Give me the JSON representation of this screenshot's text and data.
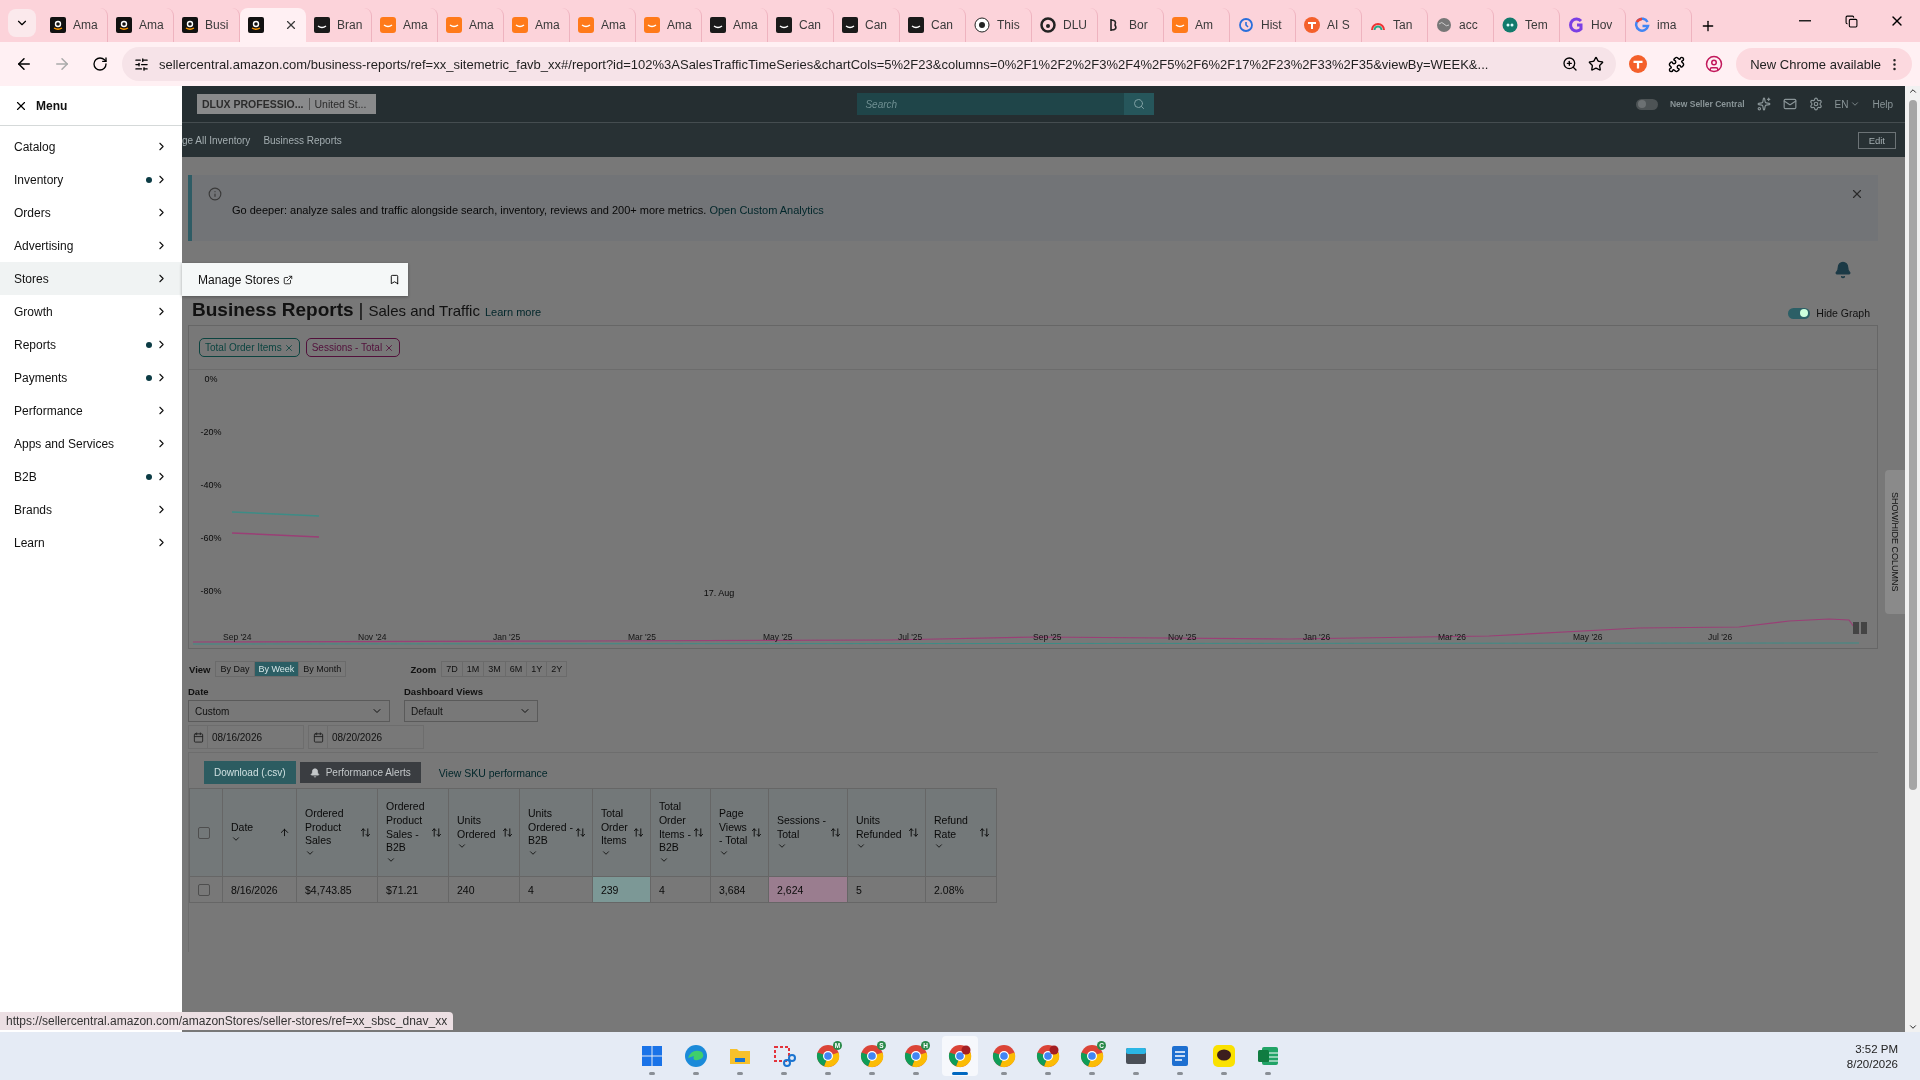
{
  "browser": {
    "tabs": [
      {
        "kind": "amazon",
        "label": "Ama",
        "selected": false
      },
      {
        "kind": "amazon",
        "label": "Ama",
        "selected": false
      },
      {
        "kind": "amazon",
        "label": "Busi",
        "selected": false
      },
      {
        "kind": "amazon",
        "selected": true
      },
      {
        "kind": "amazon-dark",
        "label": "Bran",
        "selected": false
      },
      {
        "kind": "amazon-orange",
        "label": "Ama",
        "selected": false
      },
      {
        "kind": "amazon-orange",
        "label": "Ama",
        "selected": false
      },
      {
        "kind": "amazon-orange",
        "label": "Ama",
        "selected": false
      },
      {
        "kind": "amazon-orange",
        "label": "Ama",
        "selected": false
      },
      {
        "kind": "amazon-orange",
        "label": "Ama",
        "selected": false
      },
      {
        "kind": "amazon-dark",
        "label": "Ama",
        "selected": false
      },
      {
        "kind": "amazon-dark",
        "label": "Can",
        "selected": false
      },
      {
        "kind": "amazon-dark",
        "label": "Can",
        "selected": false
      },
      {
        "kind": "amazon-dark",
        "label": "Can",
        "selected": false
      },
      {
        "kind": "eye",
        "label": "This",
        "selected": false
      },
      {
        "kind": "ring",
        "label": "DLU",
        "selected": false
      },
      {
        "kind": "letter",
        "label": "Bor",
        "selected": false
      },
      {
        "kind": "amazon-orange",
        "label": "Am",
        "selected": false
      },
      {
        "kind": "history",
        "label": "Hist",
        "selected": false
      },
      {
        "kind": "orange",
        "label": "AI S",
        "selected": false
      },
      {
        "kind": "rainbow",
        "label": "Tan",
        "selected": false
      },
      {
        "kind": "globe",
        "label": "acc",
        "selected": false
      },
      {
        "kind": "teal",
        "label": "Tem",
        "selected": false
      },
      {
        "kind": "purple",
        "label": "Hov",
        "selected": false
      },
      {
        "kind": "google",
        "label": "ima",
        "selected": false
      }
    ],
    "url": "sellercentral.amazon.com/business-reports/ref=xx_sitemetric_favb_xx#/report?id=102%3ASalesTrafficTimeSeries&chartCols=5%2F23&columns=0%2F1%2F2%2F3%2F4%2F5%2F6%2F17%2F23%2F33%2F35&viewBy=WEEK&...",
    "update_button": "New Chrome available"
  },
  "menu": {
    "title": "Menu",
    "items": [
      {
        "label": "Catalog",
        "dot": false,
        "selected": false
      },
      {
        "label": "Inventory",
        "dot": true,
        "selected": false
      },
      {
        "label": "Orders",
        "dot": false,
        "selected": false
      },
      {
        "label": "Advertising",
        "dot": false,
        "selected": false
      },
      {
        "label": "Stores",
        "dot": false,
        "selected": true
      },
      {
        "label": "Growth",
        "dot": false,
        "selected": false
      },
      {
        "label": "Reports",
        "dot": true,
        "selected": false
      },
      {
        "label": "Payments",
        "dot": true,
        "selected": false
      },
      {
        "label": "Performance",
        "dot": false,
        "selected": false
      },
      {
        "label": "Apps and Services",
        "dot": false,
        "selected": false
      },
      {
        "label": "B2B",
        "dot": true,
        "selected": false
      },
      {
        "label": "Brands",
        "dot": false,
        "selected": false
      },
      {
        "label": "Learn",
        "dot": false,
        "selected": false
      }
    ],
    "flyout": {
      "label": "Manage Stores"
    }
  },
  "header": {
    "store": "DLUX PROFESSIO...",
    "marketplace": "United St...",
    "search_placeholder": "Search",
    "toggle_label": "New Seller Central",
    "toggle_on": false,
    "language": "EN",
    "help": "Help",
    "breadcrumbs": [
      "ge All Inventory",
      "Business Reports"
    ],
    "edit": "Edit"
  },
  "banner": {
    "text": "Go deeper: analyze sales and traffic alongside search, inventory, reviews and 200+ more metrics.",
    "link": "Open Custom Analytics"
  },
  "report": {
    "title": "Business Reports",
    "separator": "|",
    "subtitle": "Sales and Traffic",
    "learn_more": "Learn more",
    "hide_graph": {
      "label": "Hide Graph",
      "on": true
    }
  },
  "chart": {
    "tags": [
      {
        "label": "Total Order Items",
        "color": "#0c4440"
      },
      {
        "label": "Sessions - Total",
        "color": "#52103b"
      }
    ],
    "y_axis_labels": [
      "0%",
      "-20%",
      "-40%",
      "-60%",
      "-80%"
    ],
    "x_axis_label": "17. Aug",
    "navigator_labels": [
      "Sep '24",
      "Nov '24",
      "Jan '25",
      "Mar '25",
      "May '25",
      "Jul '25",
      "Sep '25",
      "Nov '25",
      "Jan '26",
      "Mar '26",
      "May '26",
      "Jul '26"
    ],
    "side_tab": "SHOW/HIDE COLUMNS"
  },
  "controls": {
    "view_label": "View",
    "views": [
      {
        "label": "By Day",
        "selected": false
      },
      {
        "label": "By Week",
        "selected": true
      },
      {
        "label": "By Month",
        "selected": false
      }
    ],
    "zoom_label": "Zoom",
    "zooms": [
      {
        "label": "7D",
        "selected": false
      },
      {
        "label": "1M",
        "selected": false
      },
      {
        "label": "3M",
        "selected": false
      },
      {
        "label": "6M",
        "selected": false
      },
      {
        "label": "1Y",
        "selected": false
      },
      {
        "label": "2Y",
        "selected": false
      }
    ],
    "date_label": "Date",
    "date_range": "Custom",
    "dashboard_label": "Dashboard Views",
    "dashboard": "Default",
    "start_date": "08/16/2026",
    "end_date": "08/20/2026"
  },
  "actions": {
    "download": "Download (.csv)",
    "alerts": "Performance Alerts",
    "sku": "View SKU performance"
  },
  "table": {
    "header_checked": false,
    "columns": [
      {
        "lines": [
          "Date"
        ],
        "sorted": true
      },
      {
        "lines": [
          "Ordered",
          "Product",
          "Sales"
        ],
        "sorted": false
      },
      {
        "lines": [
          "Ordered",
          "Product",
          "Sales -",
          "B2B"
        ],
        "sorted": false
      },
      {
        "lines": [
          "Units",
          "Ordered"
        ],
        "sorted": false
      },
      {
        "lines": [
          "Units",
          "Ordered -",
          "B2B"
        ],
        "sorted": false
      },
      {
        "lines": [
          "Total",
          "Order",
          "Items"
        ],
        "sorted": false,
        "color": "#7c9896"
      },
      {
        "lines": [
          "Total",
          "Order",
          "Items -",
          "B2B"
        ],
        "sorted": false
      },
      {
        "lines": [
          "Page",
          "Views",
          "- Total"
        ],
        "sorted": false
      },
      {
        "lines": [
          "Sessions -",
          "Total"
        ],
        "sorted": false,
        "color": "#9a7d8f"
      },
      {
        "lines": [
          "Units",
          "Refunded"
        ],
        "sorted": false
      },
      {
        "lines": [
          "Refund",
          "Rate"
        ],
        "sorted": false
      }
    ],
    "rows": [
      {
        "checked": false,
        "cells": [
          "8/16/2026",
          "$4,743.85",
          "$71.21",
          "240",
          "4",
          "239",
          "4",
          "3,684",
          "2,624",
          "5",
          "2.08%"
        ]
      }
    ]
  },
  "status_url": "https://sellercentral.amazon.com/amazonStores/seller-stores/ref=xx_sbsc_dnav_xx",
  "taskbar": {
    "apps": [
      {
        "kind": "windows",
        "active": false
      },
      {
        "kind": "edge",
        "active": false
      },
      {
        "kind": "folder",
        "active": false
      },
      {
        "kind": "snip",
        "active": false
      },
      {
        "kind": "chrome",
        "badge": "M",
        "active": false
      },
      {
        "kind": "chrome",
        "badge": "S",
        "active": false
      },
      {
        "kind": "chrome",
        "badge": "H",
        "active": false
      },
      {
        "kind": "chrome-alert",
        "active": true
      },
      {
        "kind": "chrome",
        "active": false
      },
      {
        "kind": "chrome-alert",
        "active": false
      },
      {
        "kind": "chrome",
        "badge": "C",
        "active": false
      },
      {
        "kind": "keyboard",
        "active": false
      },
      {
        "kind": "notepad",
        "active": false
      },
      {
        "kind": "chat",
        "active": false
      },
      {
        "kind": "sheet",
        "active": false
      }
    ],
    "time": "3:52 PM",
    "date": "8/20/2026"
  }
}
